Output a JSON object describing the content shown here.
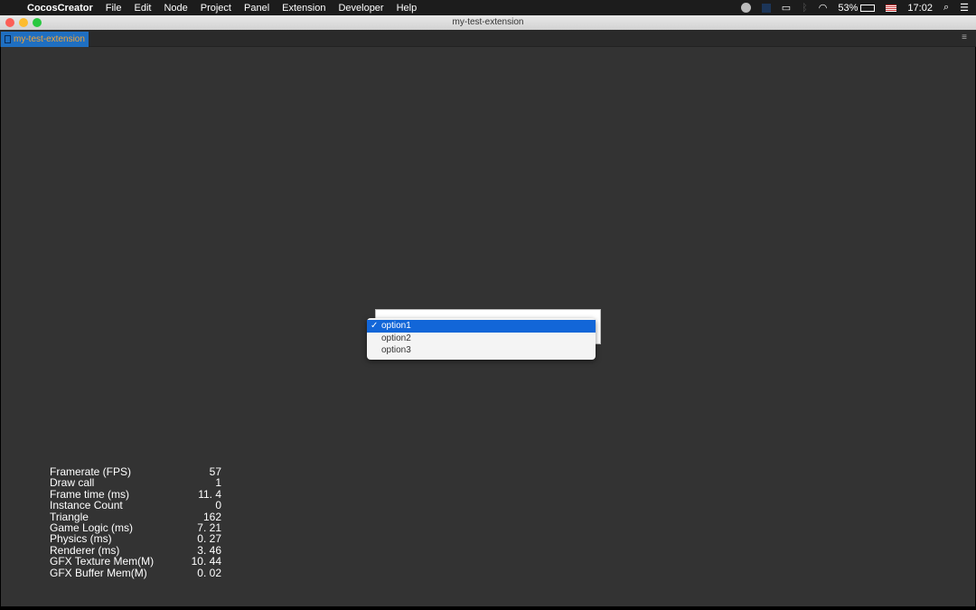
{
  "menubar": {
    "app": "CocosCreator",
    "items": [
      "File",
      "Edit",
      "Node",
      "Project",
      "Panel",
      "Extension",
      "Developer",
      "Help"
    ],
    "battery": "53%",
    "time": "17:02"
  },
  "window": {
    "title": "my-test-extension",
    "tab": "my-test-extension"
  },
  "dropdown": {
    "options": [
      "option1",
      "option2",
      "option3"
    ],
    "selected": "option1"
  },
  "stats": [
    {
      "label": "Framerate (FPS)",
      "value": "57"
    },
    {
      "label": "Draw call",
      "value": "1"
    },
    {
      "label": "Frame time (ms)",
      "value": "11. 4"
    },
    {
      "label": "Instance Count",
      "value": "0"
    },
    {
      "label": "Triangle",
      "value": "162"
    },
    {
      "label": "Game Logic (ms)",
      "value": "7. 21"
    },
    {
      "label": "Physics (ms)",
      "value": "0. 27"
    },
    {
      "label": "Renderer (ms)",
      "value": "3. 46"
    },
    {
      "label": "GFX Texture Mem(M)",
      "value": "10. 44"
    },
    {
      "label": "GFX Buffer Mem(M)",
      "value": "0. 02"
    }
  ]
}
